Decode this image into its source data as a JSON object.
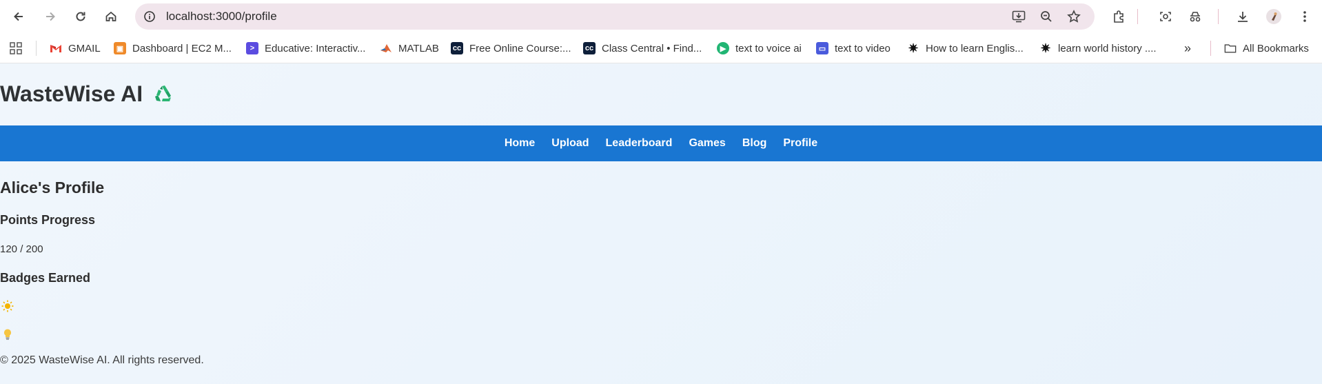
{
  "browser": {
    "url": "localhost:3000/profile",
    "bookmarks": [
      {
        "label": "GMAIL",
        "icon": "gmail-icon"
      },
      {
        "label": "Dashboard | EC2 M...",
        "icon": "aws-icon"
      },
      {
        "label": "Educative: Interactiv...",
        "icon": "educative-icon"
      },
      {
        "label": "MATLAB",
        "icon": "matlab-icon"
      },
      {
        "label": "Free Online Course:...",
        "icon": "classcentral-icon"
      },
      {
        "label": "Class Central • Find...",
        "icon": "classcentral-icon"
      },
      {
        "label": "text to voice ai",
        "icon": "play-icon"
      },
      {
        "label": "text to video",
        "icon": "video-icon"
      },
      {
        "label": "How to learn Englis...",
        "icon": "sparkle-icon"
      },
      {
        "label": "learn world history ....",
        "icon": "sparkle-icon"
      }
    ],
    "all_bookmarks": "All Bookmarks"
  },
  "site": {
    "brand": "WasteWise AI",
    "nav": [
      "Home",
      "Upload",
      "Leaderboard",
      "Games",
      "Blog",
      "Profile"
    ]
  },
  "profile": {
    "title": "Alice's Profile",
    "points_heading": "Points Progress",
    "points_text": "120 / 200",
    "badges_heading": "Badges Earned",
    "badges": [
      "sun-badge-icon",
      "lightbulb-badge-icon"
    ]
  },
  "footer": "© 2025 WasteWise AI. All rights reserved."
}
